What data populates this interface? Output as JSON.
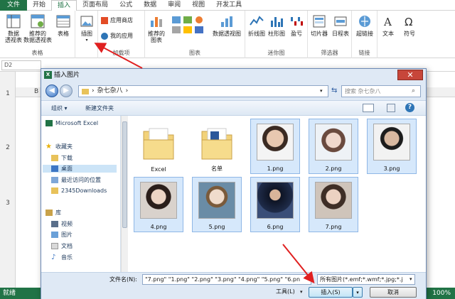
{
  "ribbon": {
    "tabs": [
      "文件",
      "开始",
      "插入",
      "页面布局",
      "公式",
      "数据",
      "审阅",
      "视图",
      "开发工具"
    ],
    "active_tab": "插入",
    "groups": {
      "tables": {
        "label": "表格",
        "buttons": [
          "数据\n透视表",
          "推荐的\n数据透视表",
          "表格"
        ]
      },
      "illustrations": {
        "label": "插图"
      },
      "addins": {
        "label": "加载项",
        "store": "应用商店",
        "myapps": "我的应用"
      },
      "charts": {
        "label": "图表",
        "recommended": "推荐的\n图表",
        "pivotchart": "数据透视图"
      },
      "sparklines": {
        "label": "迷你图",
        "buttons": [
          "折线图",
          "柱形图",
          "盈亏"
        ]
      },
      "filters": {
        "label": "筛选器",
        "buttons": [
          "切片器",
          "日程表"
        ]
      },
      "links": {
        "label": "链接",
        "buttons": [
          "超链接"
        ]
      },
      "text": {
        "label": "文本"
      },
      "symbols": {
        "label": "符号"
      }
    }
  },
  "formula_bar": {
    "name_box": "D2"
  },
  "grid": {
    "rows": [
      "1",
      "2",
      "3"
    ],
    "col_sample": "B"
  },
  "status": {
    "left": "就绪",
    "zoom": "100%"
  },
  "dialog": {
    "title": "插入图片",
    "close": "✕",
    "breadcrumb": [
      "杂七杂八"
    ],
    "search_placeholder": "搜索 杂七杂八",
    "toolbar": {
      "organize": "组织 ▾",
      "new_folder": "新建文件夹"
    },
    "nav": [
      {
        "label": "Microsoft Excel"
      },
      {
        "label": "收藏夹"
      },
      {
        "label": "下载"
      },
      {
        "label": "桌面"
      },
      {
        "label": "最近访问的位置"
      },
      {
        "label": "2345Downloads"
      },
      {
        "label": "库"
      },
      {
        "label": "视频"
      },
      {
        "label": "图片"
      },
      {
        "label": "文档"
      },
      {
        "label": "音乐"
      }
    ],
    "files": [
      {
        "label": "Excel",
        "kind": "folder"
      },
      {
        "label": "名单",
        "kind": "folder"
      },
      {
        "label": "1.png",
        "kind": "photo",
        "color": "#c9a88c"
      },
      {
        "label": "2.png",
        "kind": "photo",
        "color": "#d8bfb0"
      },
      {
        "label": "3.png",
        "kind": "photo",
        "color": "#7a6a60"
      },
      {
        "label": "4.png",
        "kind": "photo",
        "color": "#bfa898"
      },
      {
        "label": "5.png",
        "kind": "photo",
        "color": "#6d8aa0"
      },
      {
        "label": "6.png",
        "kind": "photo",
        "color": "#2c3a55"
      },
      {
        "label": "7.png",
        "kind": "photo",
        "color": "#b8a79a"
      }
    ],
    "filename_label": "文件名(N):",
    "filename_value": "\"7.png\" \"1.png\" \"2.png\" \"3.png\" \"4.png\" \"5.png\" \"6.pn",
    "filter_value": "所有图片(*.emf;*.wmf;*.jpg;*.j",
    "tools": "工具(L)",
    "insert": "插入(S)",
    "cancel": "取消"
  },
  "colors": {
    "excel_green": "#217346",
    "arrow_red": "#e02020",
    "accent_blue": "#3c7fb1"
  }
}
